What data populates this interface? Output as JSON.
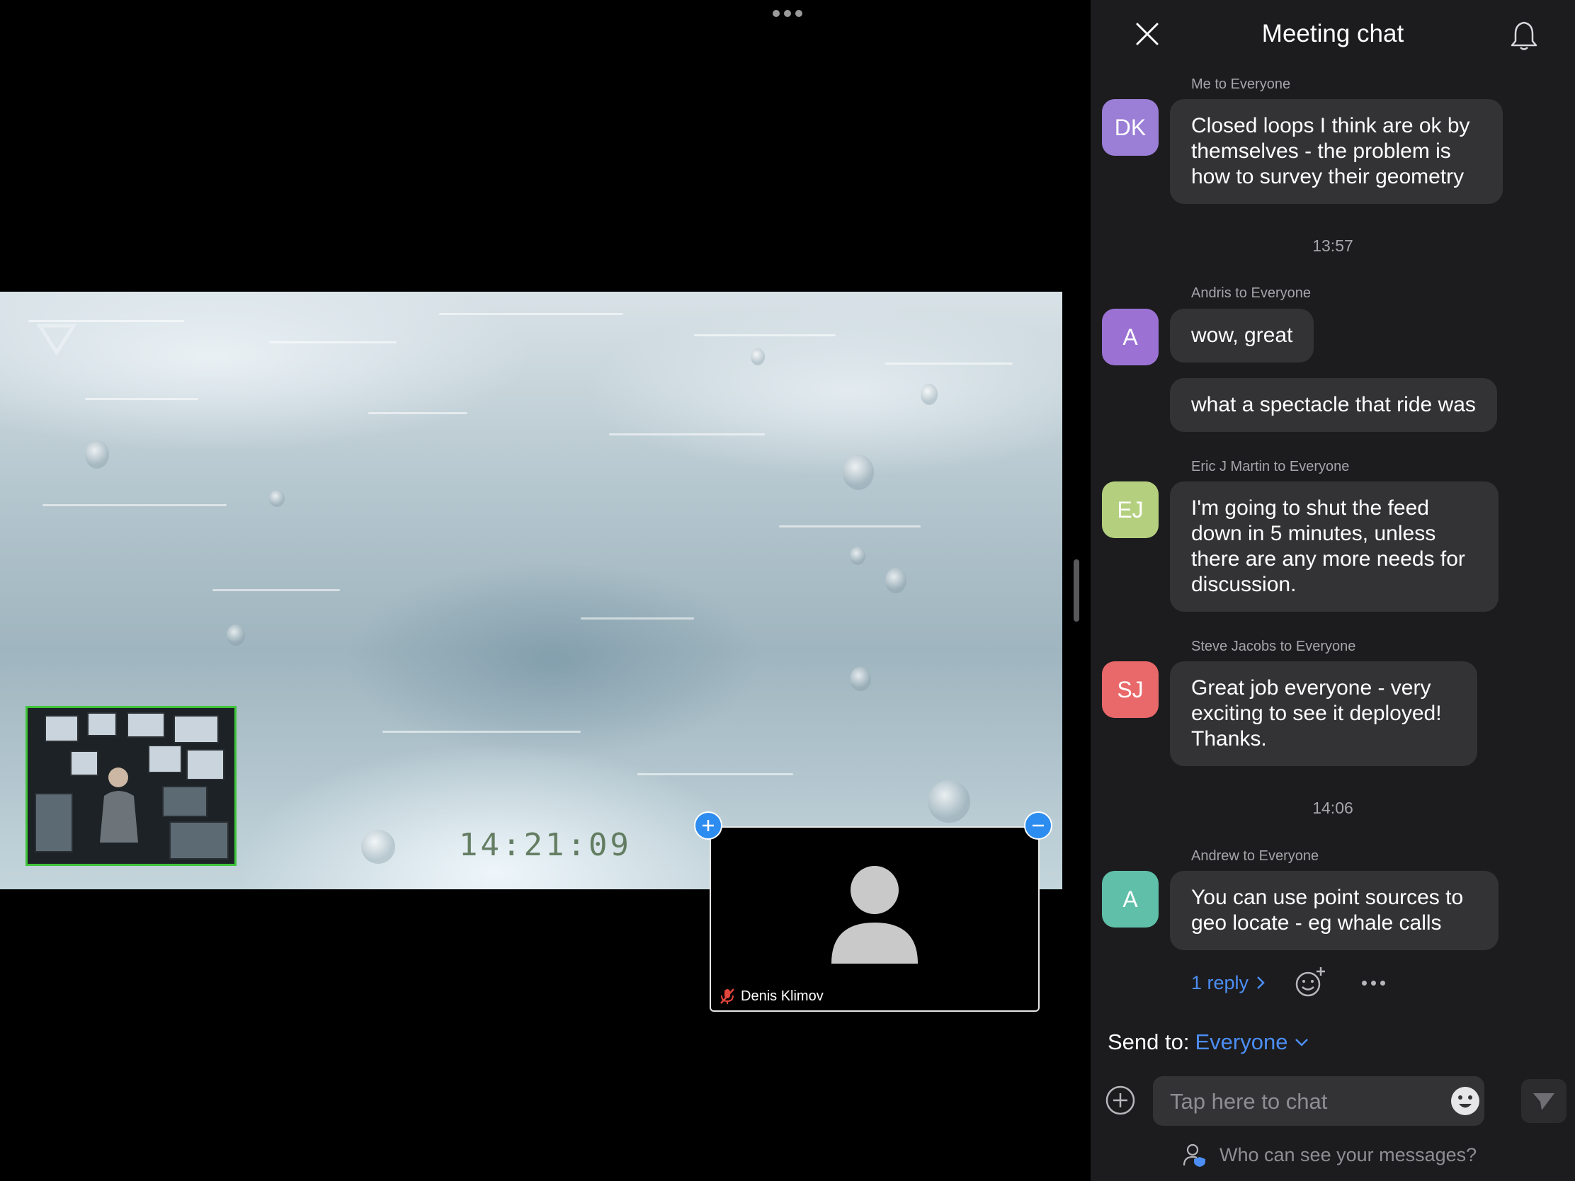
{
  "video": {
    "timestamp_overlay": "14:21:09",
    "participant": {
      "name": "Denis Klimov",
      "muted": true
    }
  },
  "chat": {
    "title": "Meeting chat",
    "messages": [
      {
        "sender": "Me to Everyone",
        "initials": "DK",
        "avatar_color": "#9b7ed6",
        "bubbles": [
          "Closed loops I think are ok by themselves - the problem is how to survey their geometry"
        ]
      },
      {
        "timestamp": "13:57"
      },
      {
        "sender": "Andris to Everyone",
        "initials": "A",
        "avatar_color": "#9b72d4",
        "bubbles": [
          "wow, great",
          "what a spectacle that ride was"
        ]
      },
      {
        "sender": "Eric J Martin to Everyone",
        "initials": "EJ",
        "avatar_color": "#b4d07f",
        "bubbles": [
          "I'm going to shut the feed down in 5 minutes, unless there are any more needs for discussion."
        ]
      },
      {
        "sender": "Steve Jacobs to Everyone",
        "initials": "SJ",
        "avatar_color": "#e9686a",
        "bubbles": [
          "Great job everyone - very exciting to see it deployed! Thanks."
        ]
      },
      {
        "timestamp": "14:06"
      },
      {
        "sender": "Andrew to Everyone",
        "initials": "A",
        "avatar_color": "#5fbfa8",
        "bubbles": [
          "You can use point sources to geo locate - eg whale calls"
        ]
      }
    ],
    "reply_link": "1 reply",
    "send_to_label": "Send to:",
    "send_to_value": "Everyone",
    "input_placeholder": "Tap here to chat",
    "visibility_text": "Who can see your messages?",
    "accent_color": "#4c8ef5"
  },
  "icons": {
    "close": "close-icon",
    "bell": "bell-icon",
    "more": "more-horizontal-icon",
    "reaction": "add-reaction-icon",
    "attach": "add-circle-icon",
    "emoji": "emoji-icon",
    "send": "send-icon",
    "visibility": "user-shield-icon",
    "mic_muted": "mic-off-icon",
    "chevron_right": "chevron-right-icon",
    "chevron_down": "chevron-down-icon"
  }
}
